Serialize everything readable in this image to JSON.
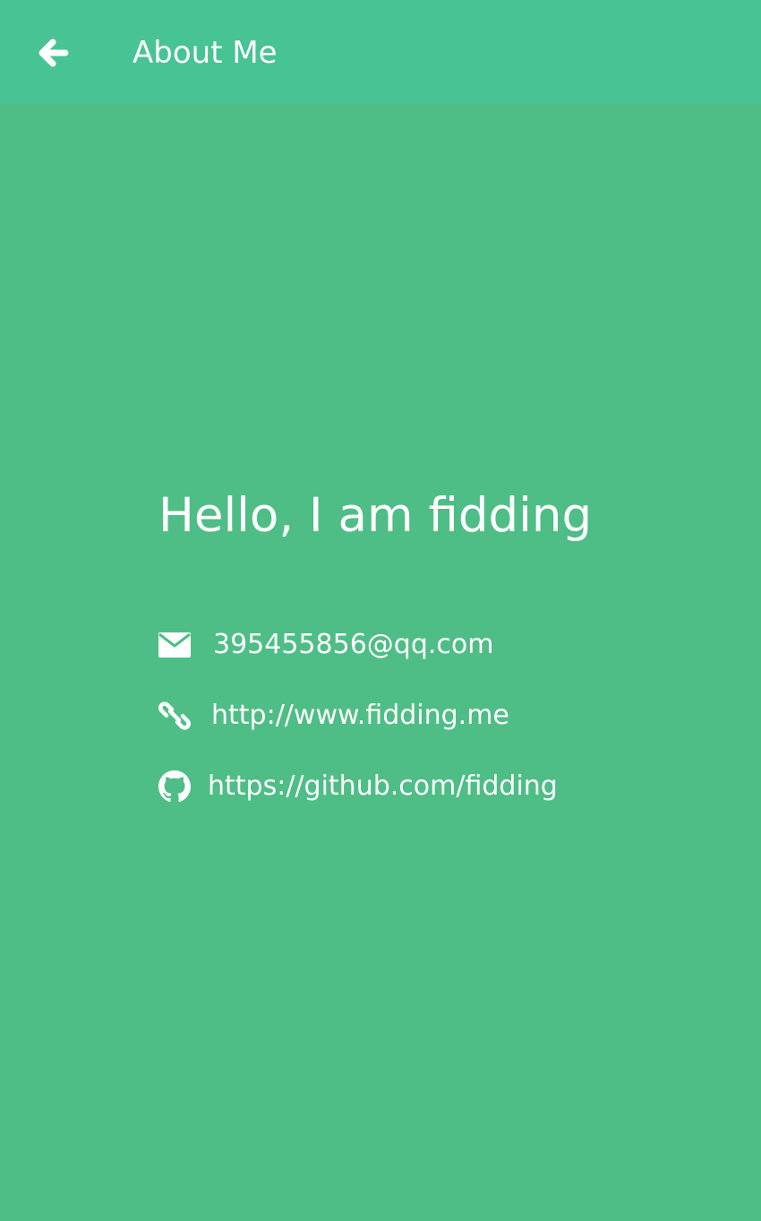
{
  "appbar": {
    "title": "About Me",
    "back_icon": "arrow-left-icon"
  },
  "profile": {
    "greeting": "Hello, I am fidding"
  },
  "contacts": [
    {
      "icon": "envelope-icon",
      "text": "395455856@qq.com"
    },
    {
      "icon": "link-icon",
      "text": "http://www.fidding.me"
    },
    {
      "icon": "github-icon",
      "text": "https://github.com/fidding"
    }
  ],
  "colors": {
    "background": "#4ebe86",
    "appbar": "#48c394",
    "text": "#ffffff"
  }
}
